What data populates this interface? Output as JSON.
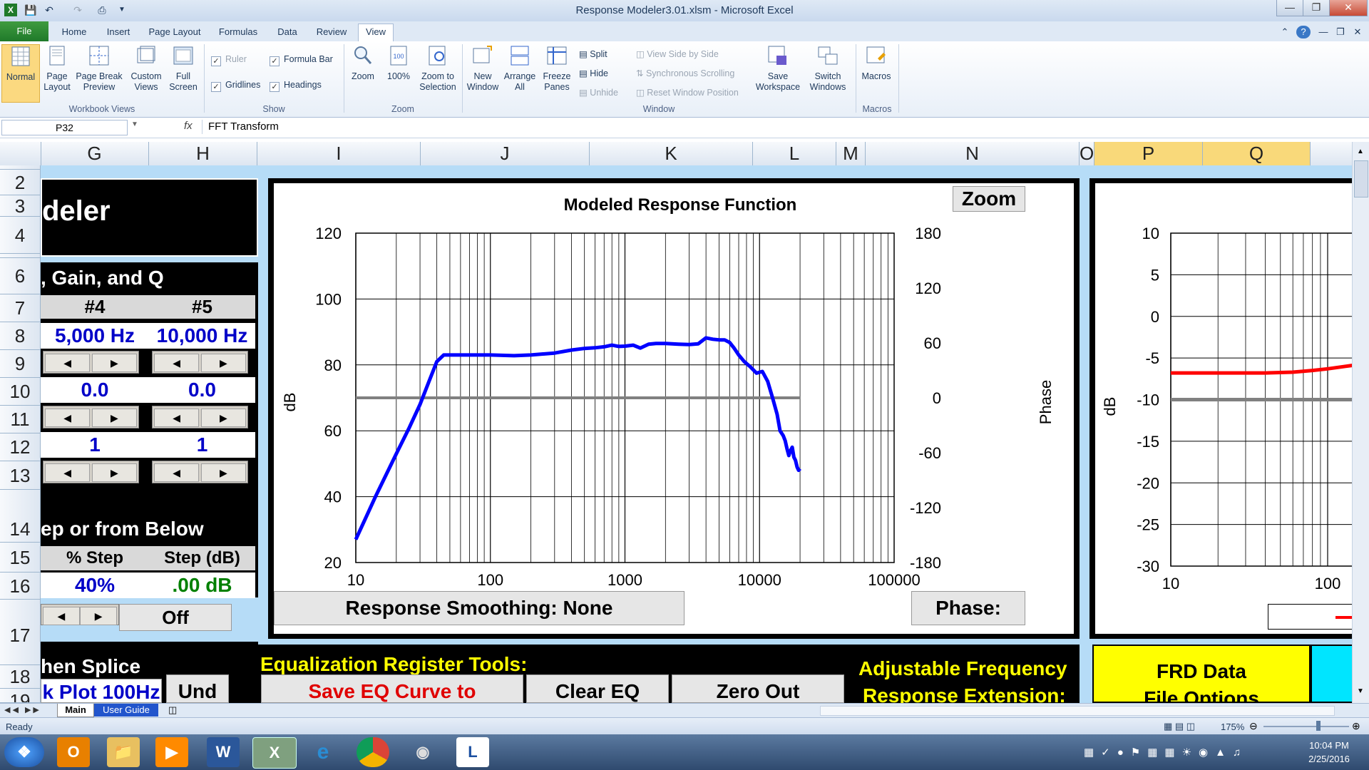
{
  "window": {
    "title": "Response Modeler3.01.xlsm - Microsoft Excel"
  },
  "ribbon": {
    "file_tab": "File",
    "tabs": [
      "Home",
      "Insert",
      "Page Layout",
      "Formulas",
      "Data",
      "Review",
      "View"
    ],
    "active_tab": "View",
    "workbook_views": {
      "normal": "Normal",
      "page_layout": "Page Layout",
      "page_break": "Page Break Preview",
      "custom": "Custom Views",
      "full": "Full Screen",
      "label": "Workbook Views"
    },
    "show": {
      "ruler": "Ruler",
      "formula_bar": "Formula Bar",
      "gridlines": "Gridlines",
      "headings": "Headings",
      "label": "Show"
    },
    "zoom": {
      "zoom": "Zoom",
      "hundred": "100%",
      "selection": "Zoom to Selection",
      "label": "Zoom"
    },
    "window": {
      "new": "New Window",
      "arrange": "Arrange All",
      "freeze": "Freeze Panes",
      "split": "Split",
      "hide": "Hide",
      "unhide": "Unhide",
      "side": "View Side by Side",
      "sync": "Synchronous Scrolling",
      "reset": "Reset Window Position",
      "save": "Save Workspace",
      "switch": "Switch Windows",
      "label": "Window"
    },
    "macros": {
      "macros": "Macros",
      "label": "Macros"
    }
  },
  "formula_bar": {
    "name_box": "P32",
    "fx": "fx",
    "formula": "FFT Transform"
  },
  "columns": [
    "G",
    "H",
    "I",
    "J",
    "K",
    "L",
    "M",
    "N",
    "O",
    "P",
    "Q"
  ],
  "rows": [
    "2",
    "3",
    "4",
    "6",
    "7",
    "8",
    "9",
    "10",
    "11",
    "12",
    "13",
    "14",
    "15",
    "16",
    "17",
    "18",
    "19"
  ],
  "sheet": {
    "title_fragment": "deler",
    "section_header": ", Gain, and Q",
    "band4": "#4",
    "band5": "#5",
    "freq4": "5,000 Hz",
    "freq5": "10,000 Hz",
    "gain4": "0.0",
    "gain5": "0.0",
    "q4": "1",
    "q5": "1",
    "step_header": "ep or from Below",
    "pct_step_label": "% Step",
    "step_db_label": "Step (dB)",
    "pct_step": "40%",
    "step_db": ".00 dB",
    "off": "Off",
    "splice": "hen Splice",
    "plot_btn": "k Plot 100Hz",
    "undo_btn": "Und",
    "eq_tools": "Equalization Register Tools:",
    "save_eq": "Save EQ Curve to",
    "clear_eq": "Clear EQ",
    "zero_out": "Zero Out",
    "adjustable": "Adjustable Frequency",
    "response_ext": "Response Extension:",
    "frd_data": "FRD Data",
    "file_options": "File Options"
  },
  "chart_data": [
    {
      "type": "line",
      "title": "Modeled Response Function",
      "xlabel": "",
      "ylabel": "dB",
      "y2label": "Phase",
      "xscale": "log",
      "xlim": [
        10,
        100000
      ],
      "ylim": [
        20,
        120
      ],
      "y2lim": [
        -180,
        180
      ],
      "xticks": [
        "10",
        "100",
        "1000",
        "10000",
        "100000"
      ],
      "yticks": [
        "20",
        "40",
        "60",
        "80",
        "100",
        "120"
      ],
      "y2ticks": [
        "-180",
        "-120",
        "-60",
        "0",
        "60",
        "120",
        "180"
      ],
      "grid": true,
      "series": [
        {
          "color": "#0000ff",
          "x": [
            10,
            14,
            20,
            25,
            30,
            35,
            40,
            45,
            50,
            70,
            100,
            150,
            200,
            300,
            400,
            500,
            600,
            700,
            800,
            900,
            1000,
            1150,
            1300,
            1500,
            1700,
            2000,
            2500,
            3000,
            3500,
            4000,
            4500,
            5000,
            5500,
            6000,
            6500,
            7000,
            7700,
            8500,
            9500,
            10500,
            11500,
            12500,
            13500,
            14200,
            15000,
            15500,
            16000,
            16500,
            17000,
            17500,
            18000,
            18500,
            19000,
            19500,
            20000
          ],
          "y": [
            27,
            40,
            53,
            61,
            68,
            75,
            81,
            83,
            83,
            83,
            83,
            82.8,
            83,
            83.6,
            84.5,
            85,
            85.2,
            85.5,
            86,
            85.6,
            85.7,
            86,
            85.1,
            86.3,
            86.5,
            86.5,
            86.3,
            86.2,
            86.4,
            88.2,
            87.8,
            87.6,
            87.6,
            86.8,
            85,
            83,
            81,
            79.5,
            77.5,
            78,
            75,
            70,
            65,
            60,
            58.5,
            57,
            54.5,
            52.5,
            54,
            55,
            52,
            51,
            49,
            48,
            48.5
          ]
        },
        {
          "color": "#808080",
          "x": [
            10,
            20000
          ],
          "y": [
            70,
            70
          ]
        }
      ]
    },
    {
      "type": "line",
      "title": "",
      "ylabel": "dB",
      "xscale": "log",
      "xticks": [
        "10",
        "100"
      ],
      "yticks": [
        "10",
        "5",
        "0",
        "-5",
        "-10",
        "-15",
        "-20",
        "-25",
        "-30"
      ],
      "ylim": [
        -30,
        10
      ],
      "grid": true,
      "series": [
        {
          "color": "#ff0000",
          "x": [
            10,
            20,
            40,
            60,
            80,
            100,
            130,
            160
          ],
          "y": [
            -6.8,
            -6.8,
            -6.8,
            -6.7,
            -6.5,
            -6.3,
            -6.0,
            -5.8
          ]
        },
        {
          "color": "#808080",
          "x": [
            10,
            160
          ],
          "y": [
            -10,
            -10
          ]
        }
      ]
    }
  ],
  "chart_buttons": {
    "zoom": "Zoom",
    "smoothing": "Response Smoothing: None",
    "phase": "Phase:"
  },
  "sheet_tabs": {
    "main": "Main",
    "guide": "User Guide"
  },
  "status": {
    "ready": "Ready",
    "zoom": "175%"
  },
  "taskbar": {
    "time": "10:04 PM",
    "date": "2/25/2016"
  }
}
